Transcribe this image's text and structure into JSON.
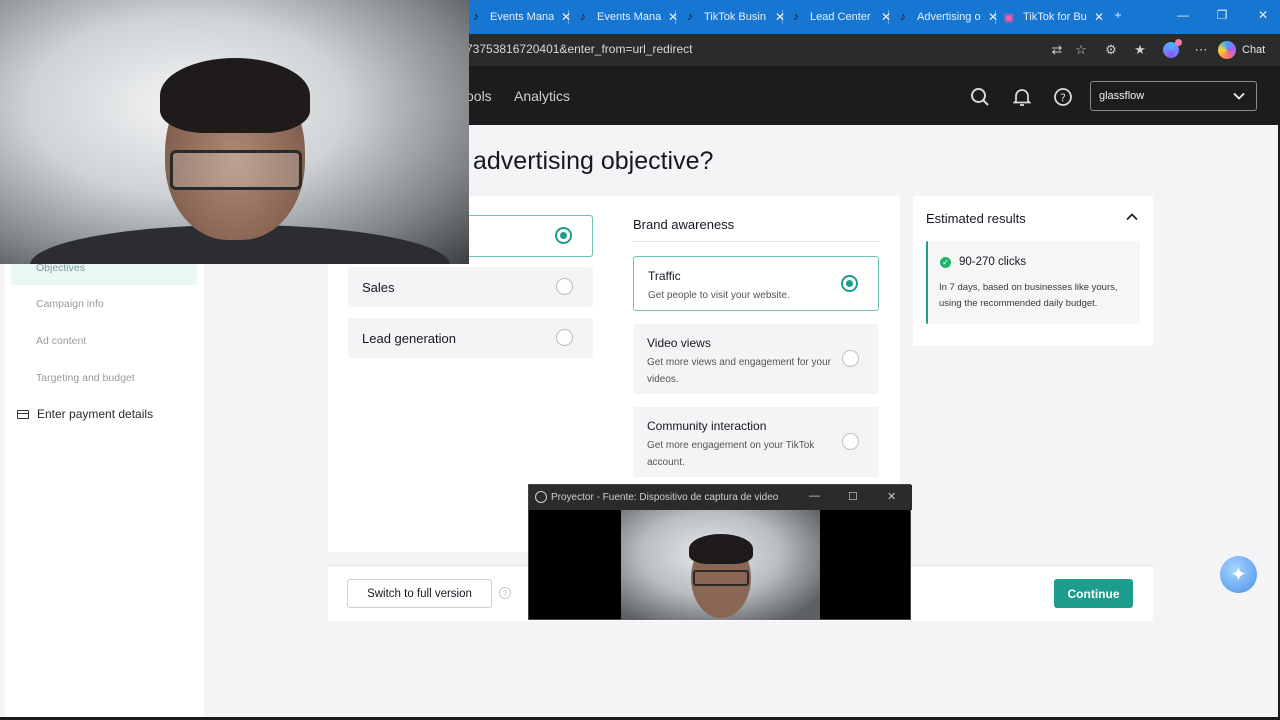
{
  "browser": {
    "tabs": [
      {
        "label": "Events Mana"
      },
      {
        "label": "Events Mana"
      },
      {
        "label": "TikTok Busin"
      },
      {
        "label": "Lead Center"
      },
      {
        "label": "Advertising o"
      },
      {
        "label": "TikTok for Bu"
      }
    ],
    "url": "73753816720401&enter_from=url_redirect",
    "chat_label": "Chat"
  },
  "header": {
    "nav_tools": "ools",
    "nav_analytics": "Analytics",
    "account_name": "glassflow"
  },
  "sidebar": {
    "items": [
      {
        "label": "Objectives"
      },
      {
        "label": "Campaign info"
      },
      {
        "label": "Ad content"
      },
      {
        "label": "Targeting and budget"
      }
    ],
    "payment_label": "Enter payment details"
  },
  "main": {
    "title": "advertising objective?",
    "left_options": [
      {
        "label": ""
      },
      {
        "label": "Sales"
      },
      {
        "label": "Lead generation"
      }
    ],
    "brand_heading": "Brand awareness",
    "right_options": [
      {
        "title": "Traffic",
        "desc": "Get people to visit your website."
      },
      {
        "title": "Video views",
        "desc": "Get more views and engagement for your videos."
      },
      {
        "title": "Community interaction",
        "desc": "Get more engagement on your TikTok account."
      }
    ]
  },
  "estimate": {
    "title": "Estimated results",
    "clicks": "90-270 clicks",
    "desc": "In 7 days, based on businesses like yours, using the recommended daily budget."
  },
  "footer": {
    "switch_label": "Switch to full version",
    "continue_label": "Continue"
  },
  "projector": {
    "title": "Proyector - Fuente: Dispositivo de captura de video"
  },
  "colors": {
    "accent": "#1d9e8c",
    "tabbar": "#1676d2"
  }
}
